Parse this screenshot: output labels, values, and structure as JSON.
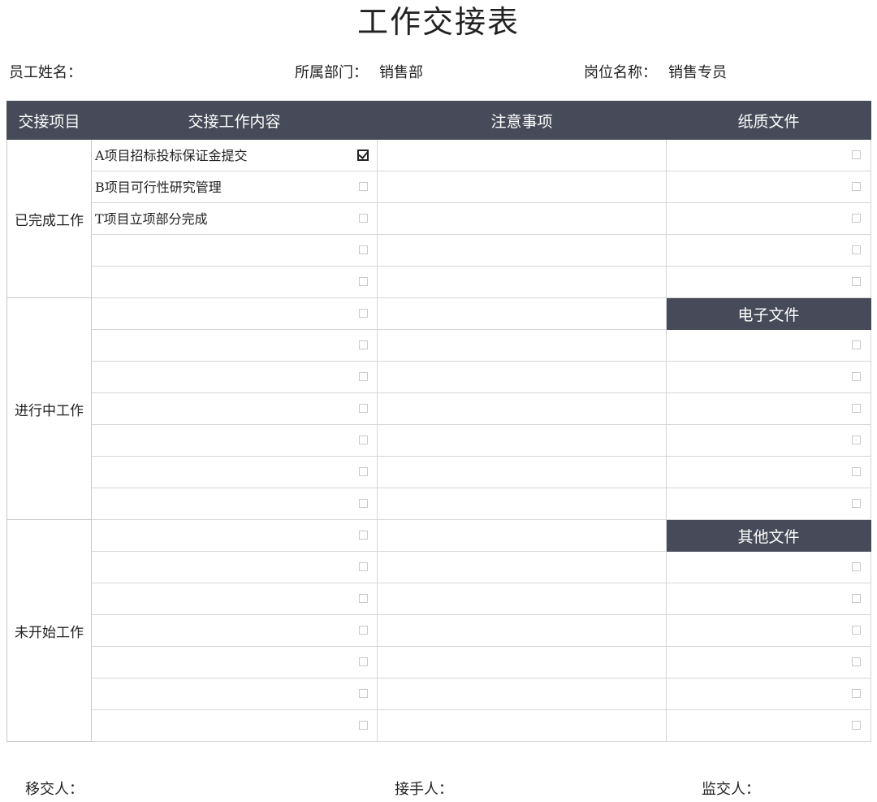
{
  "title": "工作交接表",
  "info": {
    "employee_label": "员工姓名：",
    "employee_value": "",
    "dept_label": "所属部门：",
    "dept_value": "销售部",
    "position_label": "岗位名称：",
    "position_value": "销售专员"
  },
  "headers": {
    "item": "交接项目",
    "content": "交接工作内容",
    "notes": "注意事项",
    "paper": "纸质文件",
    "electronic": "电子文件",
    "other": "其他文件"
  },
  "sections": [
    {
      "name": "已完成工作",
      "rows": [
        {
          "text": "A项目招标投标保证金提交",
          "checked": true
        },
        {
          "text": "B项目可行性研究管理",
          "checked": false
        },
        {
          "text": "T项目立项部分完成",
          "checked": false
        },
        {
          "text": "",
          "checked": false
        },
        {
          "text": "",
          "checked": false
        }
      ]
    },
    {
      "name": "进行中工作",
      "rows": [
        {
          "text": "",
          "checked": false
        },
        {
          "text": "",
          "checked": false
        },
        {
          "text": "",
          "checked": false
        },
        {
          "text": "",
          "checked": false
        },
        {
          "text": "",
          "checked": false
        },
        {
          "text": "",
          "checked": false
        },
        {
          "text": "",
          "checked": false
        }
      ]
    },
    {
      "name": "未开始工作",
      "rows": [
        {
          "text": "",
          "checked": false
        },
        {
          "text": "",
          "checked": false
        },
        {
          "text": "",
          "checked": false
        },
        {
          "text": "",
          "checked": false
        },
        {
          "text": "",
          "checked": false
        },
        {
          "text": "",
          "checked": false
        },
        {
          "text": "",
          "checked": false
        }
      ]
    }
  ],
  "footer": {
    "transferor_label": "移交人：",
    "receiver_label": "接手人：",
    "supervisor_label": "监交人："
  },
  "colors": {
    "header_bg": "#474a59",
    "header_text": "#ffffff",
    "border": "#d6d6d6"
  }
}
